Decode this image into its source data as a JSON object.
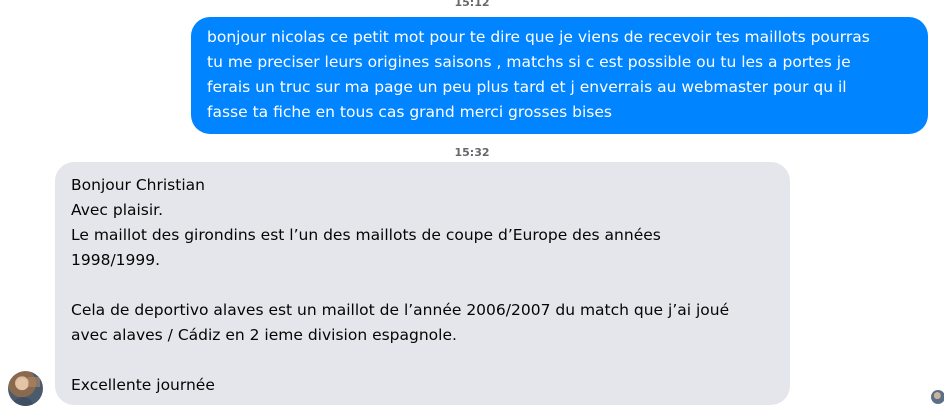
{
  "conversation": {
    "timestamps": {
      "first": "15:12",
      "second": "15:32"
    },
    "outgoing_message": {
      "text": "bonjour nicolas ce petit mot pour te dire que je viens de recevoir tes maillots pourras\ntu me preciser leurs origines saisons , matchs si c est possible ou tu les a portes je\nferais un truc sur ma page un peu plus tard et j enverrais au webmaster pour qu il\nfasse ta fiche en tous cas grand merci grosses bises",
      "bubble_color": "#0084ff"
    },
    "incoming_message": {
      "lines": [
        "Bonjour Christian",
        "Avec plaisir.",
        "Le maillot des girondins est l’un des maillots de coupe d’Europe des années",
        "1998/1999.",
        "",
        "Cela de deportivo alaves est un maillot de l’année 2006/2007 du match que j’ai joué",
        "avec alaves / Cádiz en 2 ieme division espagnole.",
        "",
        "Excellente journée"
      ],
      "bubble_color": "#e4e6eb"
    },
    "sender_avatar_icon": "avatar-photo",
    "read_receipt_icon": "seen-avatar"
  }
}
